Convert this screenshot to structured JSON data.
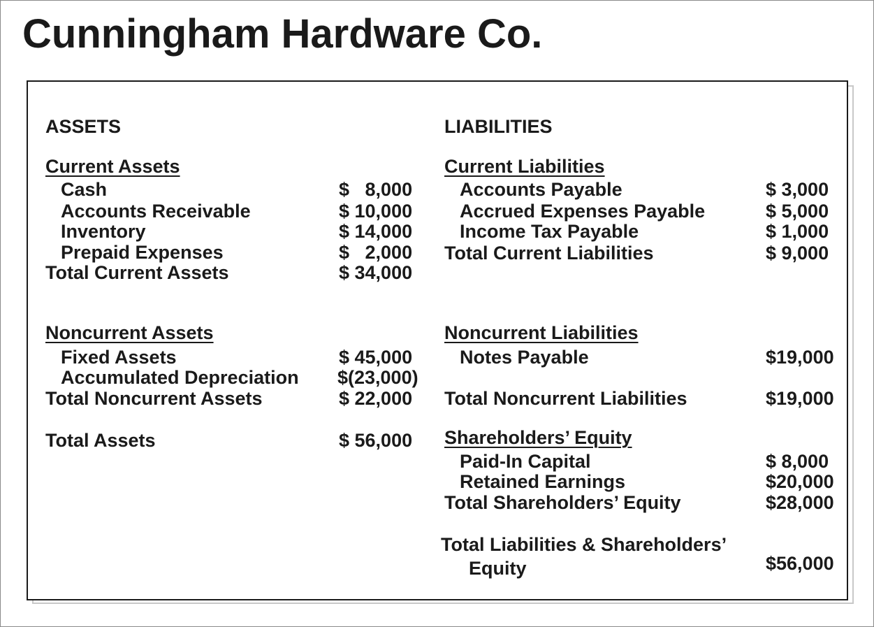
{
  "company": "Cunningham Hardware Co.",
  "assets": {
    "heading": "ASSETS",
    "current": {
      "heading": "Current Assets",
      "items": [
        {
          "label": "Cash",
          "value": "$   8,000"
        },
        {
          "label": "Accounts Receivable",
          "value": "$ 10,000"
        },
        {
          "label": "Inventory",
          "value": "$ 14,000"
        },
        {
          "label": "Prepaid Expenses",
          "value": "$   2,000"
        }
      ],
      "total_label": "Total Current Assets",
      "total_value": "$ 34,000"
    },
    "noncurrent": {
      "heading": "Noncurrent Assets",
      "items": [
        {
          "label": "Fixed Assets",
          "value": "$ 45,000"
        },
        {
          "label": "Accumulated Depreciation",
          "value": "$(23,000)"
        }
      ],
      "total_label": "Total Noncurrent Assets",
      "total_value": "$ 22,000"
    },
    "total_label": "Total Assets",
    "total_value": "$ 56,000"
  },
  "liabilities": {
    "heading": "LIABILITIES",
    "current": {
      "heading": "Current Liabilities",
      "items": [
        {
          "label": "Accounts Payable",
          "value": "$ 3,000"
        },
        {
          "label": "Accrued Expenses Payable",
          "value": "$ 5,000"
        },
        {
          "label": "Income Tax Payable",
          "value": "$ 1,000"
        }
      ],
      "total_label": "Total Current Liabilities",
      "total_value": "$ 9,000"
    },
    "noncurrent": {
      "heading": "Noncurrent Liabilities",
      "items": [
        {
          "label": "Notes Payable",
          "value": "$19,000"
        }
      ],
      "total_label": "Total Noncurrent Liabilities",
      "total_value": "$19,000"
    },
    "equity": {
      "heading": "Shareholders’ Equity",
      "items": [
        {
          "label": "Paid-In Capital",
          "value": "$ 8,000"
        },
        {
          "label": "Retained Earnings",
          "value": "$20,000"
        }
      ],
      "total_label": "Total Shareholders’ Equity",
      "total_value": "$28,000"
    },
    "grand_total_label_line1": "Total Liabilities & Shareholders’",
    "grand_total_label_line2": "Equity",
    "grand_total_value": "$56,000"
  }
}
